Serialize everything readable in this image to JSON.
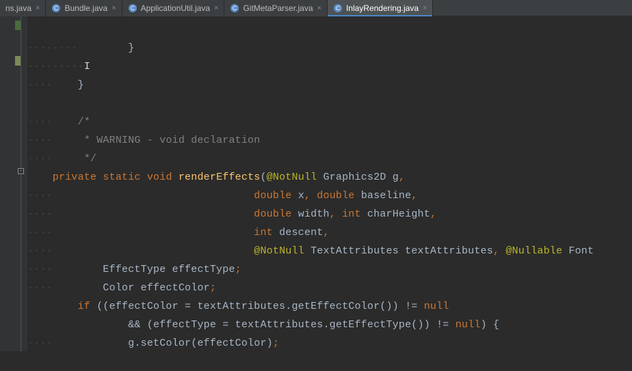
{
  "tabs": [
    {
      "label": "ns.java",
      "icon": "",
      "close": "×"
    },
    {
      "label": "Bundle.java",
      "icon": "C",
      "close": "×"
    },
    {
      "label": "ApplicationUtil.java",
      "icon": "C",
      "close": "×"
    },
    {
      "label": "GitMetaParser.java",
      "icon": "C",
      "close": "×"
    },
    {
      "label": "InlayRendering.java",
      "icon": "C",
      "close": "×",
      "active": true
    }
  ],
  "code": {
    "l1": "        }",
    "l2": "",
    "l3": "    }",
    "l4": "",
    "l5_a": "    /*",
    "l6_a": "     * WARNING - void declaration",
    "l7_a": "     */",
    "l8_kw1": "    private",
    "l8_kw2": "static",
    "l8_kw3": "void",
    "l8_method": "renderEffects",
    "l8_open": "(",
    "l8_anno": "@NotNull",
    "l8_type": "Graphics2D",
    "l8_param": "g",
    "l8_comma": ",",
    "l9_pad": "                                ",
    "l9_kw1": "double",
    "l9_p1": "x",
    "l9_c1": ",",
    "l9_kw2": "double",
    "l9_p2": "baseline",
    "l9_c2": ",",
    "l10_kw1": "double",
    "l10_p1": "width",
    "l10_c1": ",",
    "l10_kw2": "int",
    "l10_p2": "charHeight",
    "l10_c2": ",",
    "l11_kw1": "int",
    "l11_p1": "descent",
    "l11_c1": ",",
    "l12_anno1": "@NotNull",
    "l12_t1": "TextAttributes",
    "l12_p1": "textAttributes",
    "l12_c1": ",",
    "l12_anno2": "@Nullable",
    "l12_t2": "Font",
    "l13": "        EffectType effectType",
    "l13_semi": ";",
    "l14": "        Color effectColor",
    "l14_semi": ";",
    "l15_kw": "        if",
    "l15_body": " ((effectColor = textAttributes.getEffectColor()) != ",
    "l15_null": "null",
    "l16_body": "                && (effectType = textAttributes.getEffectType()) != ",
    "l16_null": "null",
    "l16_brace": ") {",
    "l17": "            g.setColor(effectColor)",
    "l17_semi": ";"
  }
}
